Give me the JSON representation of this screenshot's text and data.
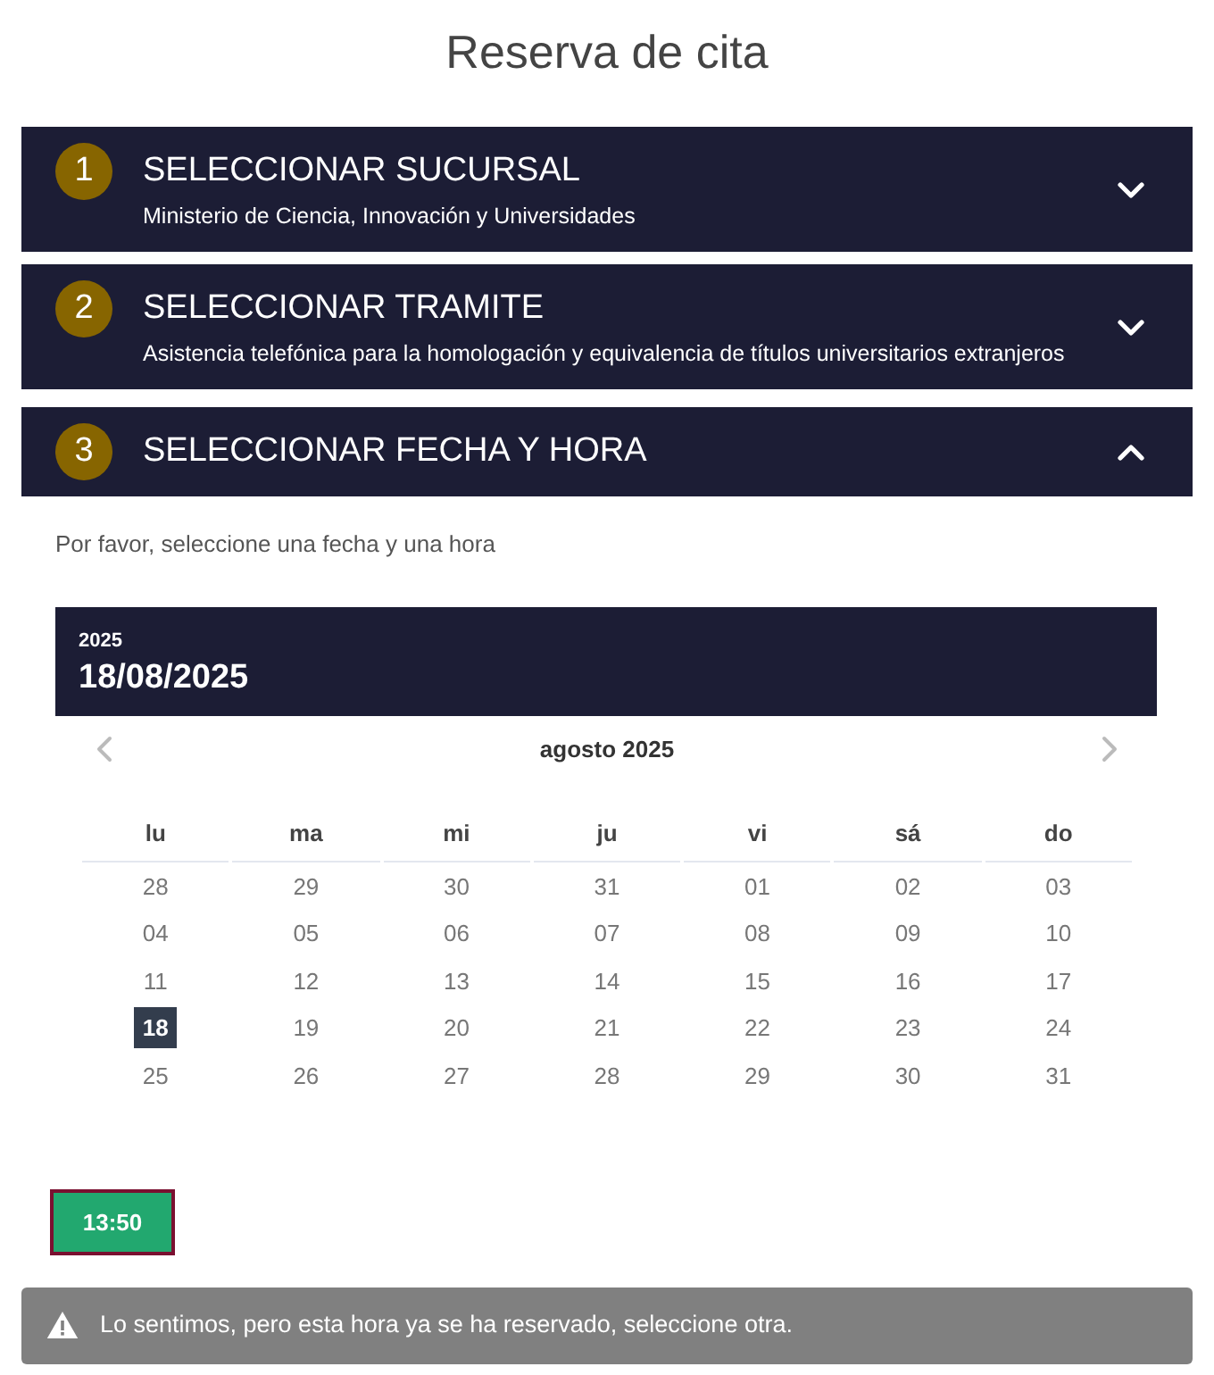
{
  "page": {
    "title": "Reserva de cita"
  },
  "steps": [
    {
      "number": "1",
      "title": "SELECCIONAR SUCURSAL",
      "summary": "Ministerio de Ciencia, Innovación y Universidades",
      "expanded": false
    },
    {
      "number": "2",
      "title": "SELECCIONAR TRAMITE",
      "summary": "Asistencia telefónica para la homologación y equivalencia de títulos universitarios extranjeros",
      "expanded": false
    },
    {
      "number": "3",
      "title": "SELECCIONAR FECHA Y HORA",
      "expanded": true
    }
  ],
  "instruction": "Por favor, seleccione una fecha y una hora",
  "datepicker": {
    "year": "2025",
    "selected_date": "18/08/2025",
    "month_label": "agosto 2025",
    "weekdays": [
      "lu",
      "ma",
      "mi",
      "ju",
      "vi",
      "sá",
      "do"
    ],
    "weeks": [
      [
        {
          "day": "28",
          "selected": false
        },
        {
          "day": "29",
          "selected": false
        },
        {
          "day": "30",
          "selected": false
        },
        {
          "day": "31",
          "selected": false
        },
        {
          "day": "01",
          "selected": false
        },
        {
          "day": "02",
          "selected": false
        },
        {
          "day": "03",
          "selected": false
        }
      ],
      [
        {
          "day": "04",
          "selected": false
        },
        {
          "day": "05",
          "selected": false
        },
        {
          "day": "06",
          "selected": false
        },
        {
          "day": "07",
          "selected": false
        },
        {
          "day": "08",
          "selected": false
        },
        {
          "day": "09",
          "selected": false
        },
        {
          "day": "10",
          "selected": false
        }
      ],
      [
        {
          "day": "11",
          "selected": false
        },
        {
          "day": "12",
          "selected": false
        },
        {
          "day": "13",
          "selected": false
        },
        {
          "day": "14",
          "selected": false
        },
        {
          "day": "15",
          "selected": false
        },
        {
          "day": "16",
          "selected": false
        },
        {
          "day": "17",
          "selected": false
        }
      ],
      [
        {
          "day": "18",
          "selected": true
        },
        {
          "day": "19",
          "selected": false
        },
        {
          "day": "20",
          "selected": false
        },
        {
          "day": "21",
          "selected": false
        },
        {
          "day": "22",
          "selected": false
        },
        {
          "day": "23",
          "selected": false
        },
        {
          "day": "24",
          "selected": false
        }
      ],
      [
        {
          "day": "25",
          "selected": false
        },
        {
          "day": "26",
          "selected": false
        },
        {
          "day": "27",
          "selected": false
        },
        {
          "day": "28",
          "selected": false
        },
        {
          "day": "29",
          "selected": false
        },
        {
          "day": "30",
          "selected": false
        },
        {
          "day": "31",
          "selected": false
        }
      ]
    ]
  },
  "time_slots": [
    {
      "label": "13:50",
      "selected": true
    }
  ],
  "alert": {
    "message": "Lo sentimos, pero esta hora ya se ha reservado, seleccione otra."
  }
}
